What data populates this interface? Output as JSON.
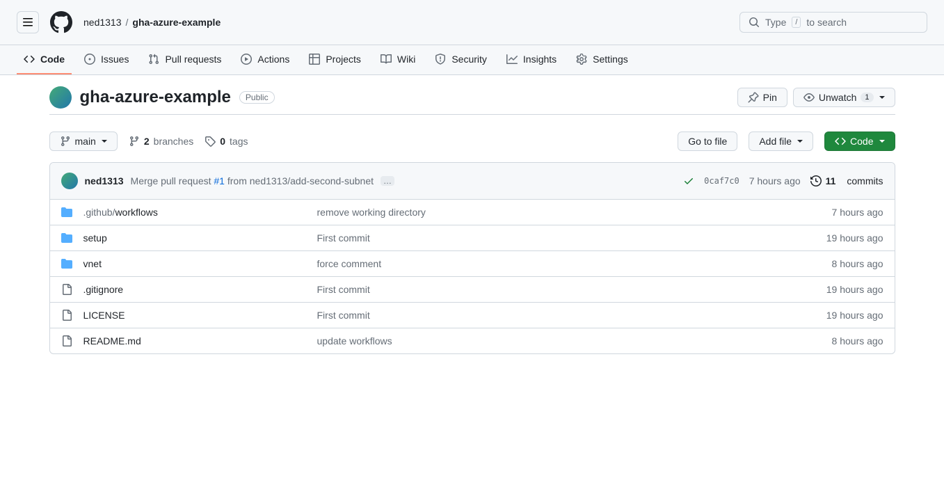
{
  "header": {
    "owner": "ned1313",
    "repo": "gha-azure-example",
    "search_placeholder_pre": "Type",
    "search_kbd": "/",
    "search_placeholder_post": "to search"
  },
  "tabs": [
    {
      "label": "Code",
      "icon": "code"
    },
    {
      "label": "Issues",
      "icon": "issue"
    },
    {
      "label": "Pull requests",
      "icon": "pr"
    },
    {
      "label": "Actions",
      "icon": "play"
    },
    {
      "label": "Projects",
      "icon": "table"
    },
    {
      "label": "Wiki",
      "icon": "book"
    },
    {
      "label": "Security",
      "icon": "shield"
    },
    {
      "label": "Insights",
      "icon": "graph"
    },
    {
      "label": "Settings",
      "icon": "gear"
    }
  ],
  "repo": {
    "name": "gha-azure-example",
    "visibility": "Public",
    "pin_label": "Pin",
    "watch_label": "Unwatch",
    "watch_count": "1"
  },
  "branch": {
    "current": "main",
    "branches_count": "2",
    "branches_label": "branches",
    "tags_count": "0",
    "tags_label": "tags"
  },
  "buttons": {
    "go_to_file": "Go to file",
    "add_file": "Add file",
    "code": "Code"
  },
  "commit": {
    "author": "ned1313",
    "message_pre": "Merge pull request",
    "pr_ref": "#1",
    "message_post": "from ned1313/add-second-subnet",
    "more": "…",
    "hash": "0caf7c0",
    "time": "7 hours ago",
    "commits_count": "11",
    "commits_label": "commits"
  },
  "files": [
    {
      "type": "folder",
      "name_pre": ".github/",
      "name": "workflows",
      "msg": "remove working directory",
      "time": "7 hours ago"
    },
    {
      "type": "folder",
      "name_pre": "",
      "name": "setup",
      "msg": "First commit",
      "time": "19 hours ago"
    },
    {
      "type": "folder",
      "name_pre": "",
      "name": "vnet",
      "msg": "force comment",
      "time": "8 hours ago"
    },
    {
      "type": "file",
      "name_pre": "",
      "name": ".gitignore",
      "msg": "First commit",
      "time": "19 hours ago"
    },
    {
      "type": "file",
      "name_pre": "",
      "name": "LICENSE",
      "msg": "First commit",
      "time": "19 hours ago"
    },
    {
      "type": "file",
      "name_pre": "",
      "name": "README.md",
      "msg": "update workflows",
      "time": "8 hours ago"
    }
  ]
}
